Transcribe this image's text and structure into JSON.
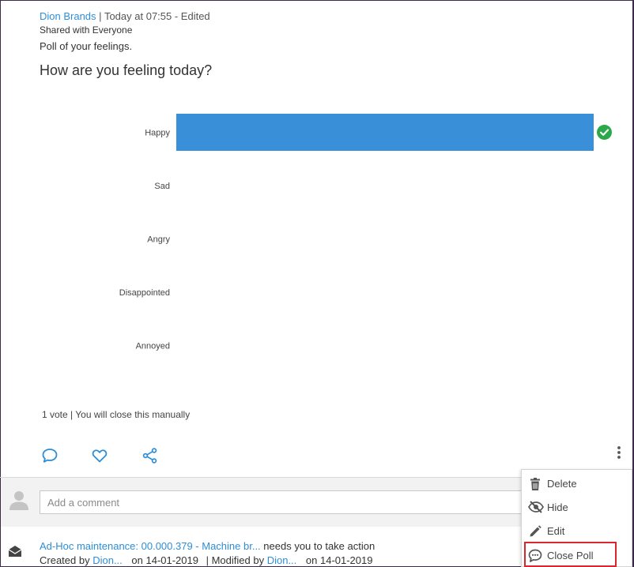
{
  "post": {
    "author": "Dion Brands",
    "separator": "|",
    "timestamp": "Today at 07:55 - Edited",
    "shared_with": "Shared with Everyone",
    "description": "Poll of your feelings.",
    "question": "How are you feeling today?",
    "vote_summary": "1 vote | You will close this manually"
  },
  "chart_data": {
    "type": "bar",
    "orientation": "horizontal",
    "categories": [
      "Happy",
      "Sad",
      "Angry",
      "Disappointed",
      "Annoyed"
    ],
    "values": [
      1,
      0,
      0,
      0,
      0
    ],
    "color": "#3a8fd9",
    "selected_category": "Happy",
    "selected_marker_color": "#2aa84a"
  },
  "actions": {
    "comment_icon": "comment-icon",
    "like_icon": "heart-icon",
    "share_icon": "share-icon",
    "more_icon": "kebab-icon"
  },
  "comment": {
    "placeholder": "Add a comment"
  },
  "feed_item": {
    "title_link": "Ad-Hoc maintenance: 00.000.379 - Machine br...",
    "title_suffix": " needs you to take action",
    "created_label": "Created by ",
    "created_by": "Dion...",
    "created_on": "on 14-01-2019",
    "modified_label": "| Modified by ",
    "modified_by": "Dion...",
    "modified_on": "on 14-01-2019"
  },
  "menu": {
    "items": [
      {
        "label": "Delete",
        "icon": "trash-icon"
      },
      {
        "label": "Hide",
        "icon": "eye-slash-icon"
      },
      {
        "label": "Edit",
        "icon": "pencil-icon"
      },
      {
        "label": "Close Poll",
        "icon": "chat-bubble-icon"
      }
    ]
  },
  "colors": {
    "link": "#2d8ed8",
    "bar": "#3a8fd9",
    "highlight": "#d7262c"
  }
}
